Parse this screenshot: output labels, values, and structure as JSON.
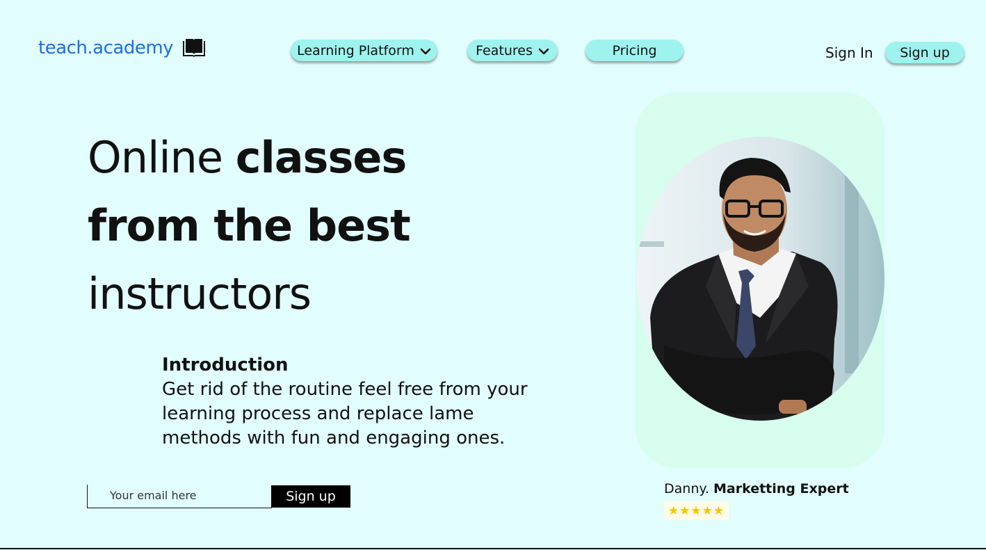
{
  "header": {
    "logo_text": "teach.academy",
    "logo_icon": "book-icon",
    "nav": [
      {
        "label": "Learning Platform",
        "has_dropdown": true
      },
      {
        "label": "Features",
        "has_dropdown": true
      },
      {
        "label": "Pricing",
        "has_dropdown": false
      }
    ],
    "sign_in_label": "Sign In",
    "sign_up_label": "Sign up"
  },
  "hero": {
    "headline_line1_regular": "Online ",
    "headline_line1_bold": "classes",
    "headline_line2_bold": "from the best",
    "headline_line3_regular": "instructors",
    "intro_title": "Introduction",
    "intro_text": "Get rid of the routine feel free from your learning process and replace lame methods with fun and engaging ones."
  },
  "signup_form": {
    "email_placeholder": "Your email here",
    "button_label": "Sign up"
  },
  "testimonial": {
    "name": "Danny.",
    "role": "Marketting Expert",
    "stars": "★★★★★",
    "rating": 5
  },
  "colors": {
    "background": "#e1fdfd",
    "pill": "#9ef3ee",
    "logo_blue": "#1b6fe0",
    "card": "#d6fded",
    "star": "#f5c200"
  }
}
